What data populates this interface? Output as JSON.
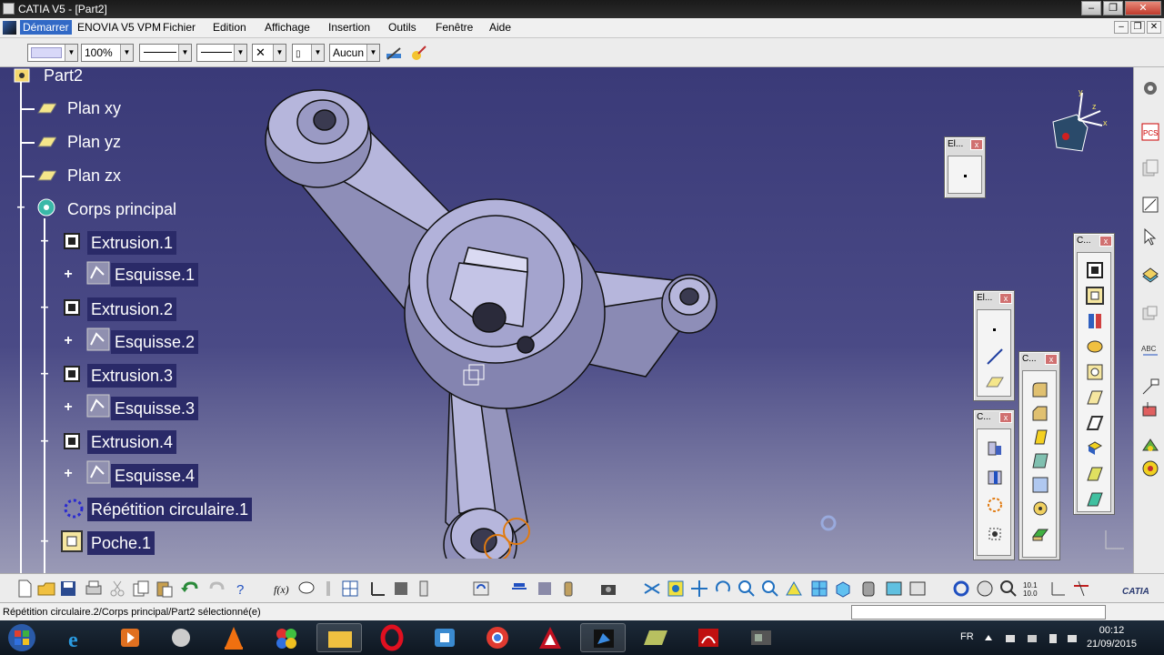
{
  "window": {
    "title": "CATIA V5 - [Part2]"
  },
  "menu": {
    "start": "Démarrer",
    "items": [
      "ENOVIA V5 VPM",
      "Fichier",
      "Edition",
      "Affichage",
      "Insertion",
      "Outils",
      "Fenêtre",
      "Aide"
    ]
  },
  "toolbar": {
    "zoom": "100%",
    "layer": "Aucun"
  },
  "tree": {
    "root": "Part2",
    "plane_xy": "Plan xy",
    "plane_yz": "Plan yz",
    "plane_zx": "Plan zx",
    "body": "Corps principal",
    "extrusion1": "Extrusion.1",
    "sketch1": "Esquisse.1",
    "extrusion2": "Extrusion.2",
    "sketch2": "Esquisse.2",
    "extrusion3": "Extrusion.3",
    "sketch3": "Esquisse.3",
    "extrusion4": "Extrusion.4",
    "sketch4": "Esquisse.4",
    "circular_pattern": "Répétition circulaire.1",
    "pocket": "Poche.1"
  },
  "panels": {
    "elements_small": "El...",
    "elements_tall": "El...",
    "c_left": "C...",
    "c_mid": "C...",
    "c_right": "C..."
  },
  "status": {
    "message": "Répétition circulaire.2/Corps principal/Part2 sélectionné(e)"
  },
  "taskbar": {
    "lang": "FR",
    "time": "00:12",
    "date": "21/09/2015"
  },
  "colors": {
    "viewport_top": "#3a3a78",
    "part_fill": "#b8b8e0",
    "selection_orange": "#e07a10"
  }
}
